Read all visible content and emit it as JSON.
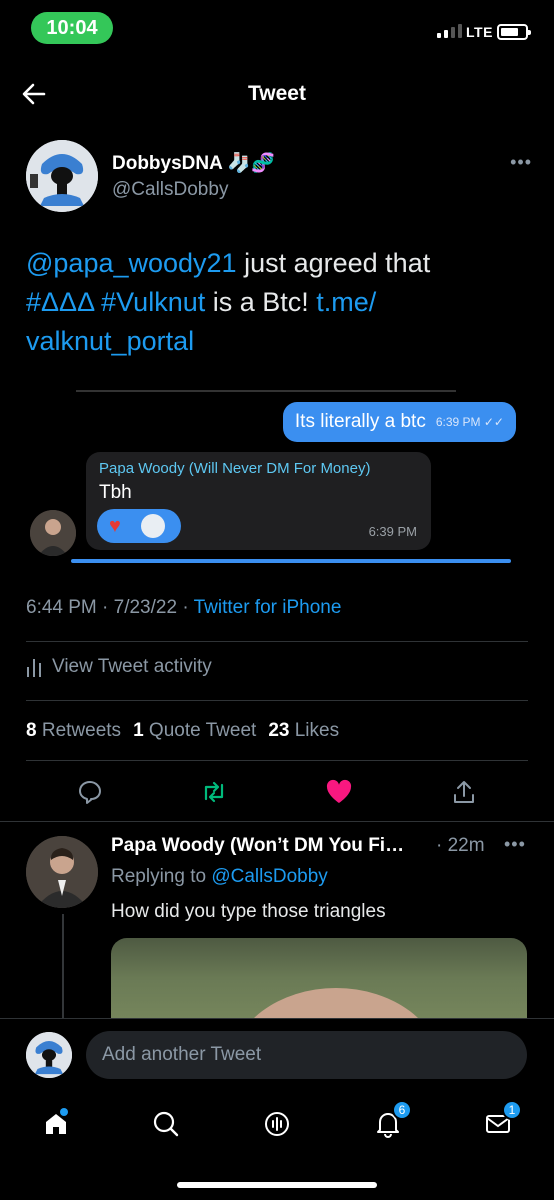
{
  "status": {
    "time": "10:04",
    "network": "LTE"
  },
  "header": {
    "title": "Tweet"
  },
  "author": {
    "name": "DobbysDNA",
    "handle": "@CallsDobby"
  },
  "tweet": {
    "mention": "@papa_woody21",
    "text1": " just agreed that ",
    "hashtag1": "#ΔΔΔ",
    "hashtag2": "#Vulknut",
    "text2": " is a Btc! ",
    "link1": "t.me/",
    "link2": "valknut_portal"
  },
  "media": {
    "outgoing_text": "Its literally a btc",
    "outgoing_time": "6:39 PM",
    "incoming_sender": "Papa Woody (Will Never DM For Money)",
    "incoming_text": "Tbh",
    "incoming_time": "6:39 PM"
  },
  "meta": {
    "timestamp": "6:44 PM · 7/23/22 · ",
    "source": "Twitter for iPhone"
  },
  "activity": {
    "label": "View Tweet activity"
  },
  "stats": {
    "retweets_count": "8",
    "retweets_label": "Retweets",
    "quotes_count": "1",
    "quotes_label": "Quote Tweet",
    "likes_count": "23",
    "likes_label": "Likes"
  },
  "actions": {
    "reply_icon": "reply-icon",
    "retweet_icon": "retweet-icon",
    "like_icon": "heart-icon",
    "share_icon": "share-icon",
    "retweet_color": "#00ba7c",
    "like_color": "#f91880"
  },
  "reply": {
    "name": "Papa Woody (Won’t DM You Fi…",
    "age": " · 22m",
    "replying_prefix": "Replying to ",
    "replying_handle": "@CallsDobby",
    "text": "How did you type those triangles"
  },
  "compose": {
    "placeholder": "Add another Tweet"
  },
  "nav": {
    "notifications_badge": "6",
    "messages_badge": "1"
  },
  "colors": {
    "accent": "#1d9bf0",
    "background": "#000000"
  }
}
